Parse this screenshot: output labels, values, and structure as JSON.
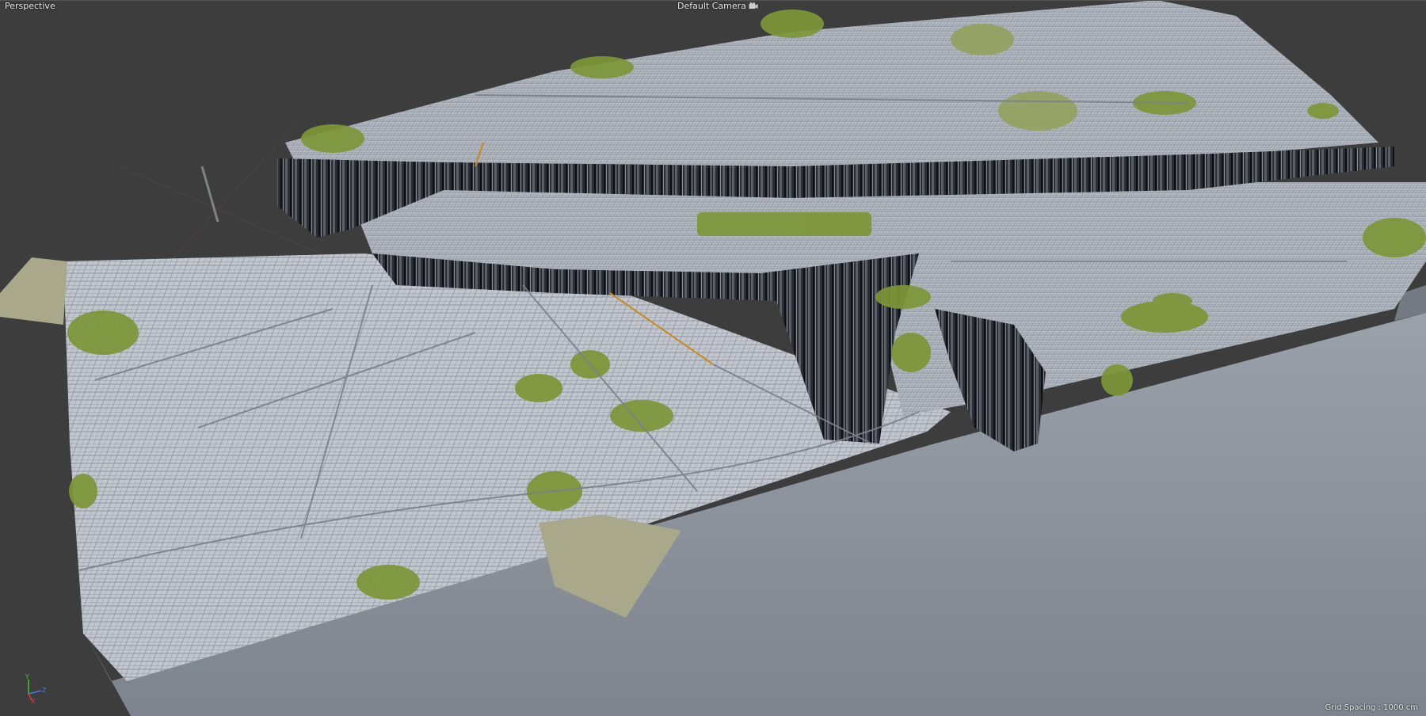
{
  "viewport": {
    "view_mode": "Perspective",
    "camera": "Default Camera",
    "camera_icon": "camera-icon",
    "grid_spacing": "Grid Spacing : 1000 cm"
  },
  "axis_gizmo": {
    "y": "Y",
    "z": "Z",
    "x": "X"
  },
  "colors": {
    "background": "#3d3d3d",
    "base_slab": "#8c939c",
    "city_surface": "#b9bdc6",
    "cliff": "#262a30",
    "vegetation": "#7d9637",
    "sand": "#a9a88a",
    "axis_x": "#e03a3a",
    "axis_y": "#46c046",
    "axis_z": "#4a78e0"
  }
}
